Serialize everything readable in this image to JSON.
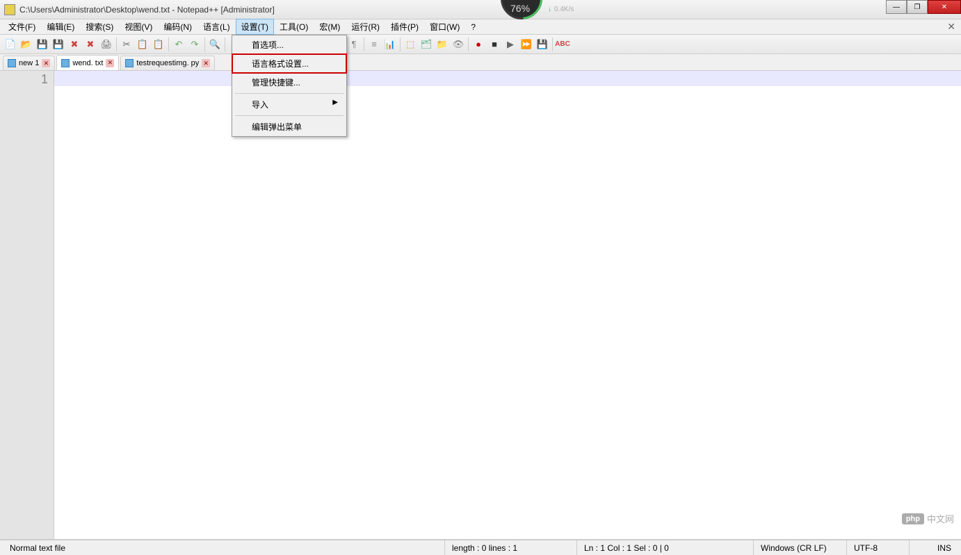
{
  "title": "C:\\Users\\Administrator\\Desktop\\wend.txt - Notepad++ [Administrator]",
  "gauge": {
    "percent": "76%",
    "speed": "0.4K/s"
  },
  "menu": {
    "items": [
      "文件(F)",
      "编辑(E)",
      "搜索(S)",
      "视图(V)",
      "编码(N)",
      "语言(L)",
      "设置(T)",
      "工具(O)",
      "宏(M)",
      "运行(R)",
      "插件(P)",
      "窗口(W)",
      "?"
    ],
    "active_index": 6
  },
  "dropdown": {
    "items": [
      {
        "label": "首选项...",
        "sep_after": false
      },
      {
        "label": "语言格式设置...",
        "highlighted": true
      },
      {
        "label": "管理快捷键...",
        "sep_after": true
      },
      {
        "label": "导入",
        "submenu": true,
        "sep_after": true
      },
      {
        "label": "编辑弹出菜单"
      }
    ]
  },
  "tabs": [
    {
      "label": "new 1",
      "active": false
    },
    {
      "label": "wend. txt",
      "active": true
    },
    {
      "label": "testrequestimg. py",
      "active": false
    }
  ],
  "gutter": {
    "line1": "1"
  },
  "statusbar": {
    "filetype": "Normal text file",
    "length": "length : 0    lines : 1",
    "position": "Ln : 1    Col : 1    Sel : 0 | 0",
    "encoding": "Windows (CR LF)",
    "charset": "UTF-8",
    "mode": "INS"
  },
  "watermark": {
    "badge": "php",
    "text": "中文网"
  },
  "window_controls": {
    "min": "—",
    "max": "❐",
    "close": "✕"
  },
  "toolbar_icons": [
    "📄",
    "📂",
    "💾",
    "💾",
    "✖",
    "✖",
    "🖨",
    "✂",
    "📋",
    "📋",
    "↶",
    "↷",
    "🔍",
    "¶",
    "≡",
    "📊",
    "⬚",
    "🗂",
    "📁",
    "👁",
    "●",
    "■",
    "▶",
    "⏩",
    "💾",
    "ABC"
  ]
}
